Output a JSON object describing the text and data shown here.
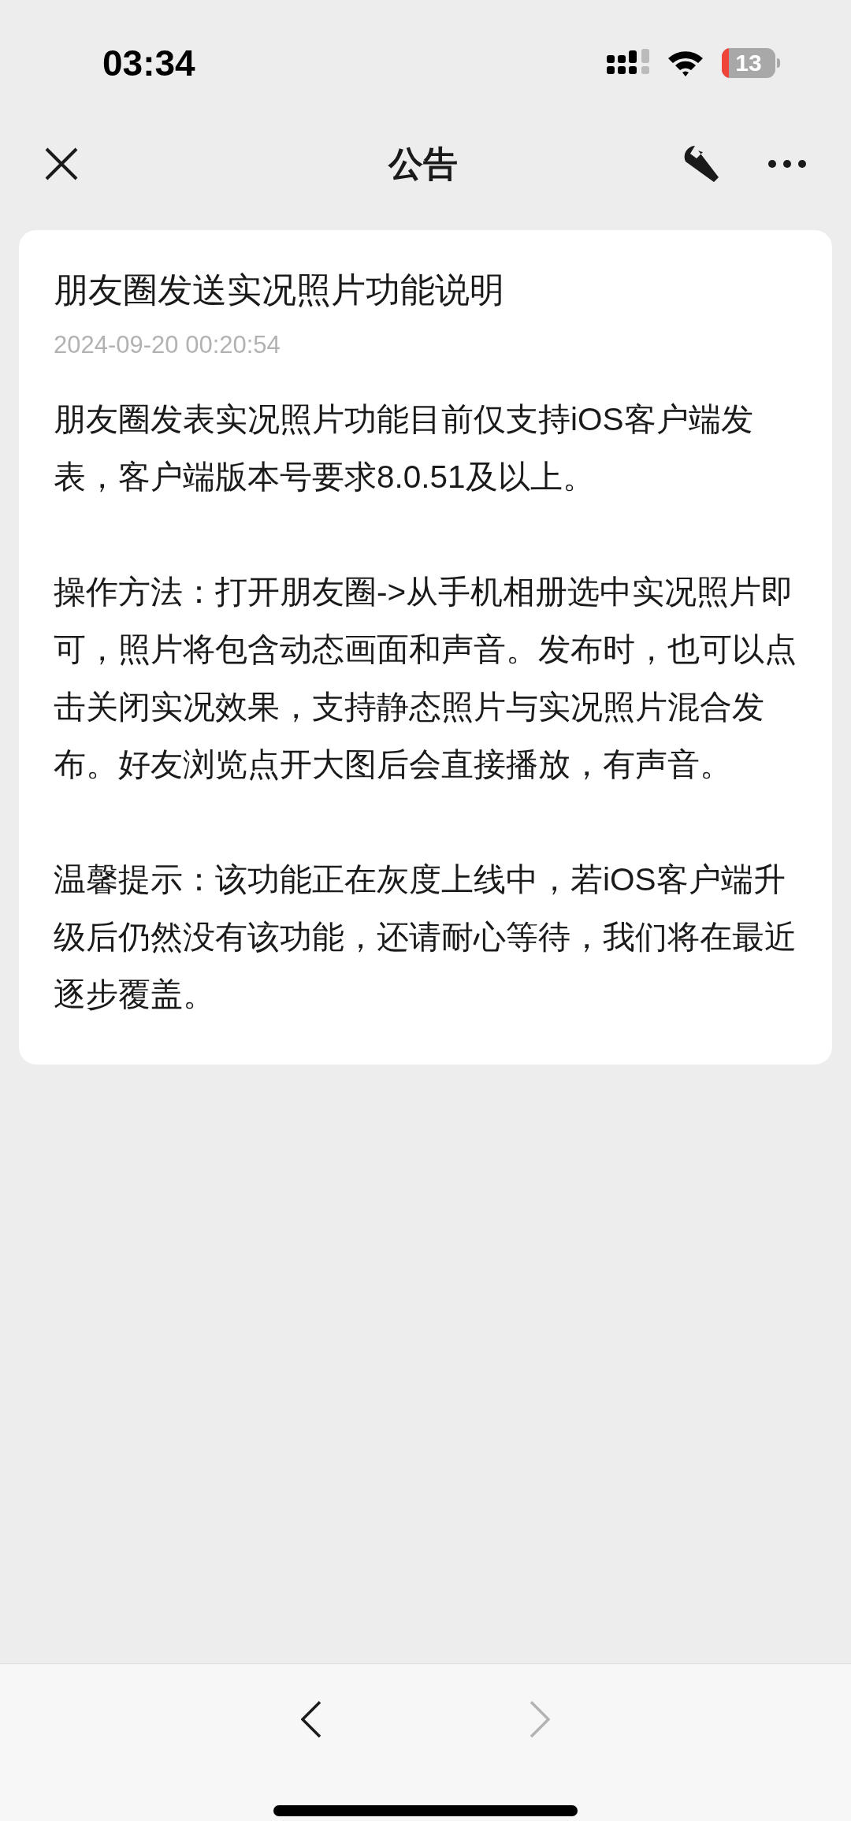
{
  "status_bar": {
    "time": "03:34",
    "battery": "13"
  },
  "nav": {
    "title": "公告"
  },
  "notice": {
    "title": "朋友圈发送实况照片功能说明",
    "date": "2024-09-20 00:20:54",
    "paragraphs": [
      "朋友圈发表实况照片功能目前仅支持iOS客户端发表，客户端版本号要求8.0.51及以上。",
      "操作方法：打开朋友圈->从手机相册选中实况照片即可，照片将包含动态画面和声音。发布时，也可以点击关闭实况效果，支持静态照片与实况照片混合发布。好友浏览点开大图后会直接播放，有声音。",
      "温馨提示：该功能正在灰度上线中，若iOS客户端升级后仍然没有该功能，还请耐心等待，我们将在最近逐步覆盖。"
    ]
  },
  "bottom_nav": {
    "back": {
      "disabled": false
    },
    "forward": {
      "disabled": true
    }
  }
}
